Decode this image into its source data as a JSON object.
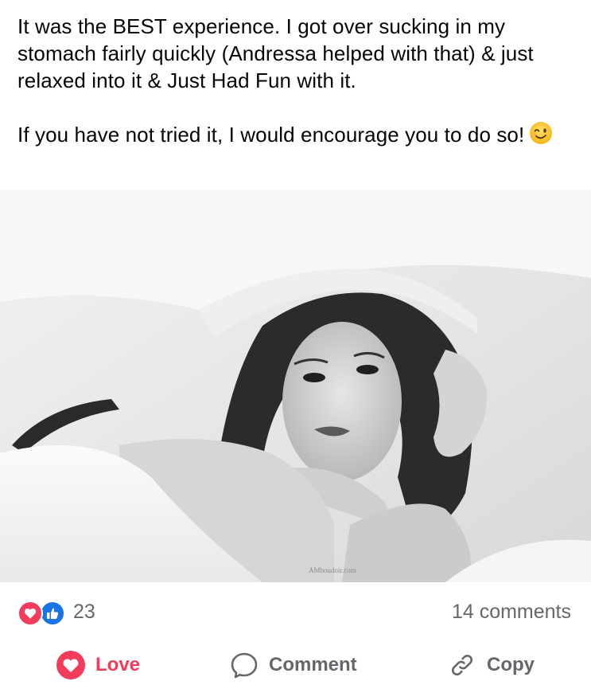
{
  "post": {
    "paragraph_1": "It was the BEST experience. I got over sucking in my stomach fairly quickly (Andressa helped with that) & just relaxed into it & Just Had Fun with it.",
    "paragraph_2": "If you have not tried it, I would encourage you to do so!",
    "emoji": "winking-face-emoji"
  },
  "photo": {
    "watermark": "AMboudoir.com"
  },
  "engagement": {
    "reaction_icons": [
      "love-icon",
      "like-icon"
    ],
    "reaction_count": "23",
    "comment_count": "14 comments"
  },
  "actions": {
    "love_label": "Love",
    "comment_label": "Comment",
    "copy_label": "Copy"
  },
  "colors": {
    "love": "#f23c5b",
    "like": "#1b74e4",
    "secondary_text": "#65676b"
  }
}
